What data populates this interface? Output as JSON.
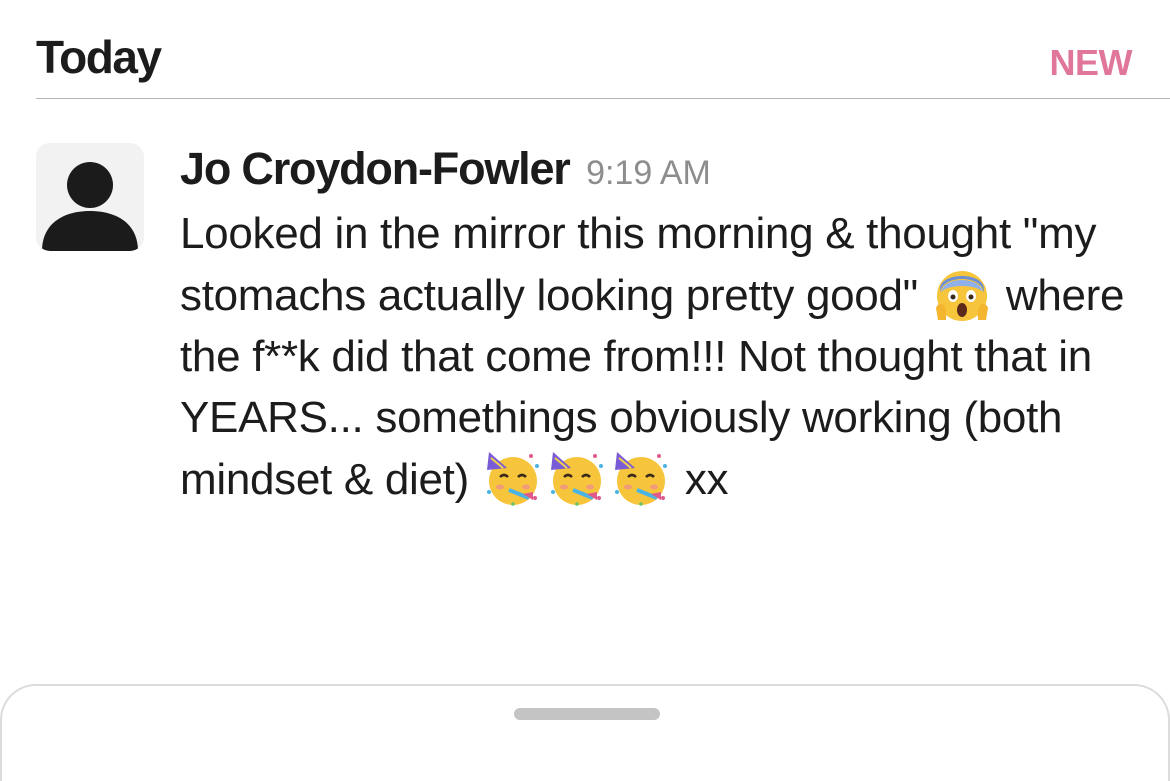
{
  "divider": {
    "day_label": "Today",
    "new_label": "NEW"
  },
  "message": {
    "avatar_icon": "default-person-avatar",
    "author": "Jo Croydon-Fowler",
    "timestamp": "9:19 AM",
    "text_part1": "Looked in the mirror this morning & thought \"my stomachs actually looking pretty good\"",
    "emoji_1": "face-screaming-in-fear",
    "text_part2": "where the f**k did that come from!!! Not thought that in YEARS... somethings obviously working (both mindset & diet)",
    "emoji_2": [
      "partying-face",
      "partying-face",
      "partying-face"
    ],
    "text_part3": "xx"
  },
  "bottom_sheet": {
    "handle_icon": "drag-handle"
  },
  "colors": {
    "new_accent": "#e0779b",
    "text": "#1d1c1d",
    "timestamp": "#8d8d8d",
    "divider": "#b5b5b5"
  }
}
